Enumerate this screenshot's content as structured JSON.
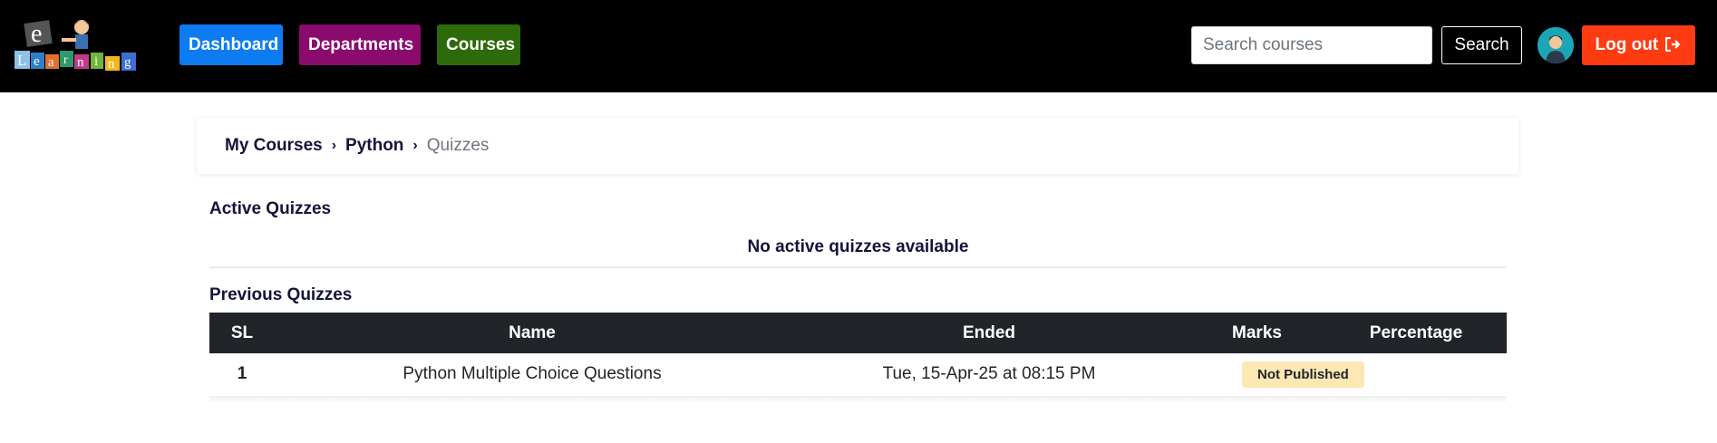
{
  "nav": {
    "logo_text": "eLearning",
    "buttons": [
      {
        "label": "Dashboard",
        "color": "#0d7cf2"
      },
      {
        "label": "Departments",
        "color": "#8b0a6e"
      },
      {
        "label": "Courses",
        "color": "#2d6a0a"
      }
    ],
    "search_placeholder": "Search courses",
    "search_button": "Search",
    "logout_label": "Log out",
    "logout_icon": "sign-out-icon"
  },
  "breadcrumb": {
    "items": [
      "My Courses",
      "Python"
    ],
    "separator": "›",
    "current": "Quizzes"
  },
  "active_quizzes": {
    "title": "Active Quizzes",
    "empty_message": "No active quizzes available"
  },
  "previous_quizzes": {
    "title": "Previous Quizzes",
    "columns": [
      "SL",
      "Name",
      "Ended",
      "Marks",
      "Percentage"
    ],
    "rows": [
      {
        "sl": "1",
        "name": "Python Multiple Choice Questions",
        "ended": "Tue, 15-Apr-25 at 08:15 PM",
        "status": "Not Published"
      }
    ]
  }
}
